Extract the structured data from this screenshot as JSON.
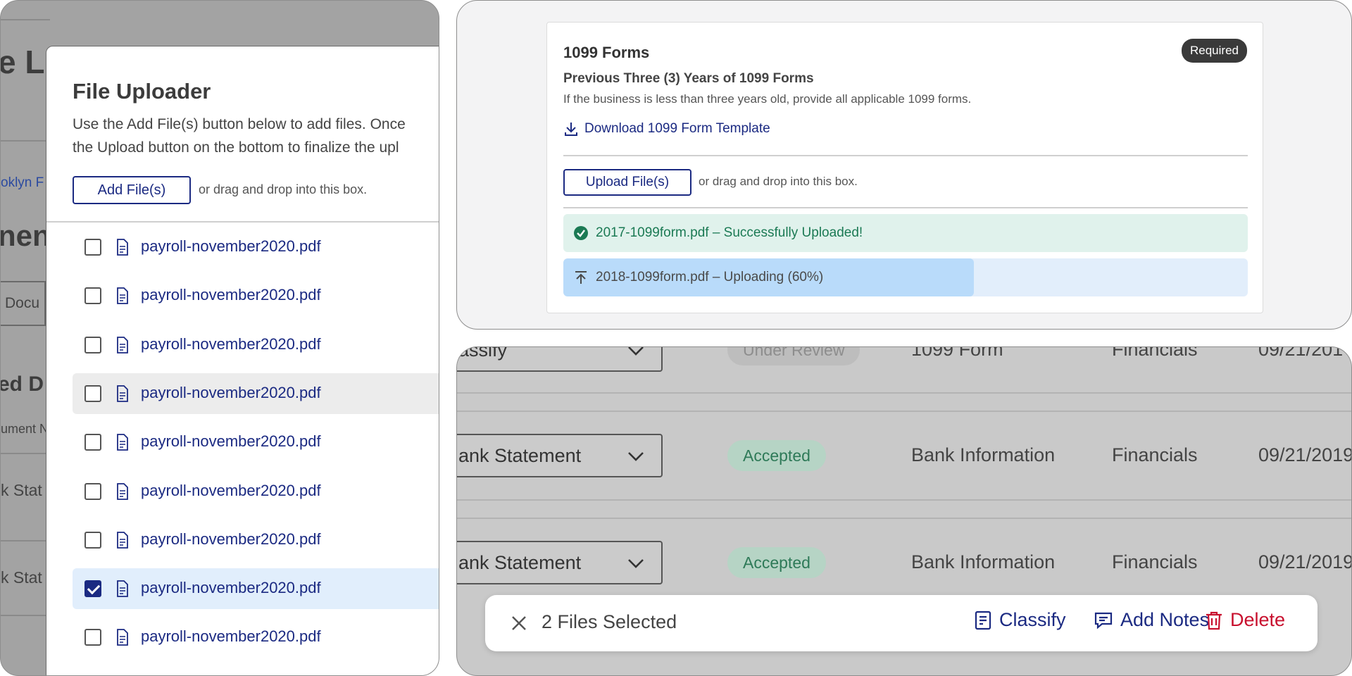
{
  "background": {
    "partial_title": "e L",
    "partial_link": "oklyn F",
    "partial_heading": "nen",
    "partial_tab": "Docu",
    "partial_section": "ed D",
    "partial_col": "ument N",
    "partial_row1": "k Stat",
    "partial_row2": "k Stat"
  },
  "file_uploader": {
    "title": "File Uploader",
    "desc_line1": "Use the Add File(s) button below to add files. Once",
    "desc_line2": "the Upload button on the bottom to finalize the upl",
    "add_button": "Add File(s)",
    "drag_hint": "or drag and drop into this box.",
    "files": [
      {
        "name": "payroll-november2020.pdf",
        "checked": false
      },
      {
        "name": "payroll-november2020.pdf",
        "checked": false
      },
      {
        "name": "payroll-november2020.pdf",
        "checked": false
      },
      {
        "name": "payroll-november2020.pdf",
        "checked": false
      },
      {
        "name": "payroll-november2020.pdf",
        "checked": false
      },
      {
        "name": "payroll-november2020.pdf",
        "checked": false
      },
      {
        "name": "payroll-november2020.pdf",
        "checked": false
      },
      {
        "name": "payroll-november2020.pdf",
        "checked": true
      },
      {
        "name": "payroll-november2020.pdf",
        "checked": false
      }
    ]
  },
  "form_card": {
    "title": "1099 Forms",
    "badge": "Required",
    "subtitle": "Previous Three (3) Years of 1099 Forms",
    "help": "If the business is less than three years old, provide all applicable 1099 forms.",
    "download_link": "Download 1099 Form Template",
    "upload_button": "Upload File(s)",
    "drag_hint": "or drag and drop into this box.",
    "success_text": "2017-1099form.pdf – Successfully Uploaded!",
    "uploading_text": "2018-1099form.pdf – Uploading (60%)",
    "upload_progress": 0.6
  },
  "table": {
    "rows": [
      {
        "classify": "assify",
        "status": "Under Review",
        "doc": "1099 Form",
        "category": "Financials",
        "date": "09/21/201"
      },
      {
        "classify": "ank Statement",
        "status": "Accepted",
        "doc": "Bank Information",
        "category": "Financials",
        "date": "09/21/2019"
      },
      {
        "classify": "ank Statement",
        "status": "Accepted",
        "doc": "Bank Information",
        "category": "Financials",
        "date": "09/21/2019"
      }
    ]
  },
  "selection_bar": {
    "count_label": "2 Files Selected",
    "classify": "Classify",
    "add_notes": "Add Notes",
    "delete": "Delete"
  },
  "colors": {
    "primary": "#1b2a82",
    "success": "#1b7a54",
    "danger": "#c8102e"
  }
}
